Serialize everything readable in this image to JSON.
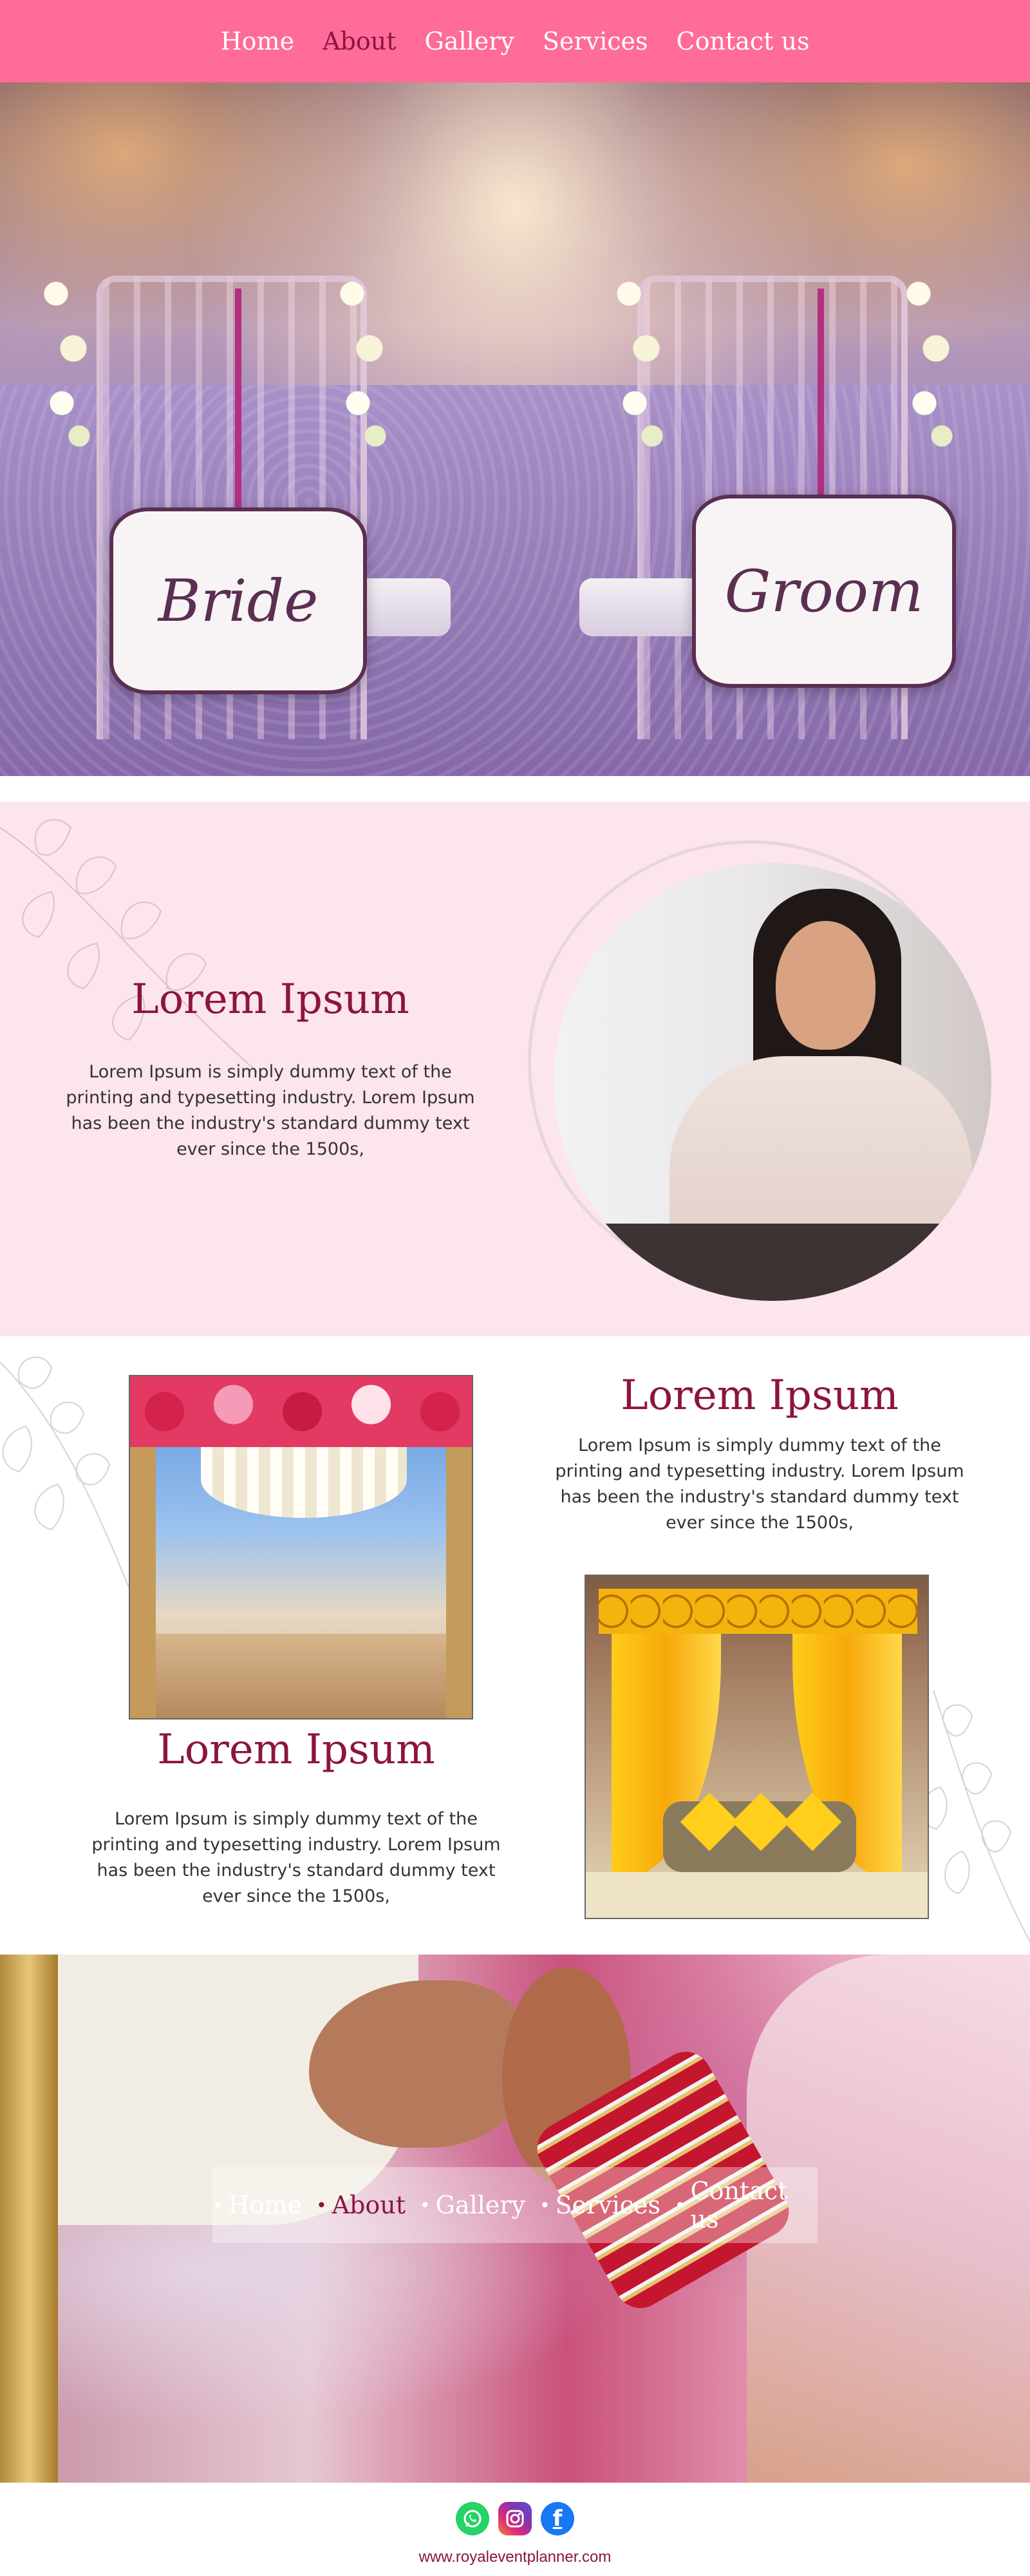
{
  "nav": {
    "items": [
      {
        "label": "Home"
      },
      {
        "label": "About"
      },
      {
        "label": "Gallery"
      },
      {
        "label": "Services"
      },
      {
        "label": "Contact us"
      }
    ],
    "active": "About"
  },
  "hero": {
    "sign_left": "Bride",
    "sign_right": "Groom"
  },
  "about": {
    "title": "Lorem Ipsum",
    "text": "Lorem Ipsum is simply dummy text of the printing and typesetting industry. Lorem Ipsum has been the industry's standard dummy text ever since the 1500s,"
  },
  "features": {
    "block_right_title": "Lorem Ipsum",
    "block_right_text": "Lorem Ipsum is simply dummy text of the printing and typesetting industry. Lorem Ipsum has been the industry's standard dummy text ever since the 1500s,",
    "block_left_title": "Lorem Ipsum",
    "block_left_text": "Lorem Ipsum is simply dummy text of the printing and typesetting industry. Lorem Ipsum has been the industry's standard dummy text ever since the 1500s,"
  },
  "bottom_nav": {
    "bullet": "•",
    "items": [
      {
        "label": "Home"
      },
      {
        "label": "About"
      },
      {
        "label": "Gallery"
      },
      {
        "label": "Services"
      },
      {
        "label": "Contact us"
      }
    ],
    "active": "About"
  },
  "footer": {
    "social_icons": [
      "whatsapp-icon",
      "instagram-icon",
      "facebook-icon"
    ],
    "facebook_glyph": "f",
    "url": "www.royaleventplanner.com"
  },
  "colors": {
    "nav_bg": "#ff6c99",
    "accent": "#8c1540",
    "about_bg": "#fce5ec"
  }
}
